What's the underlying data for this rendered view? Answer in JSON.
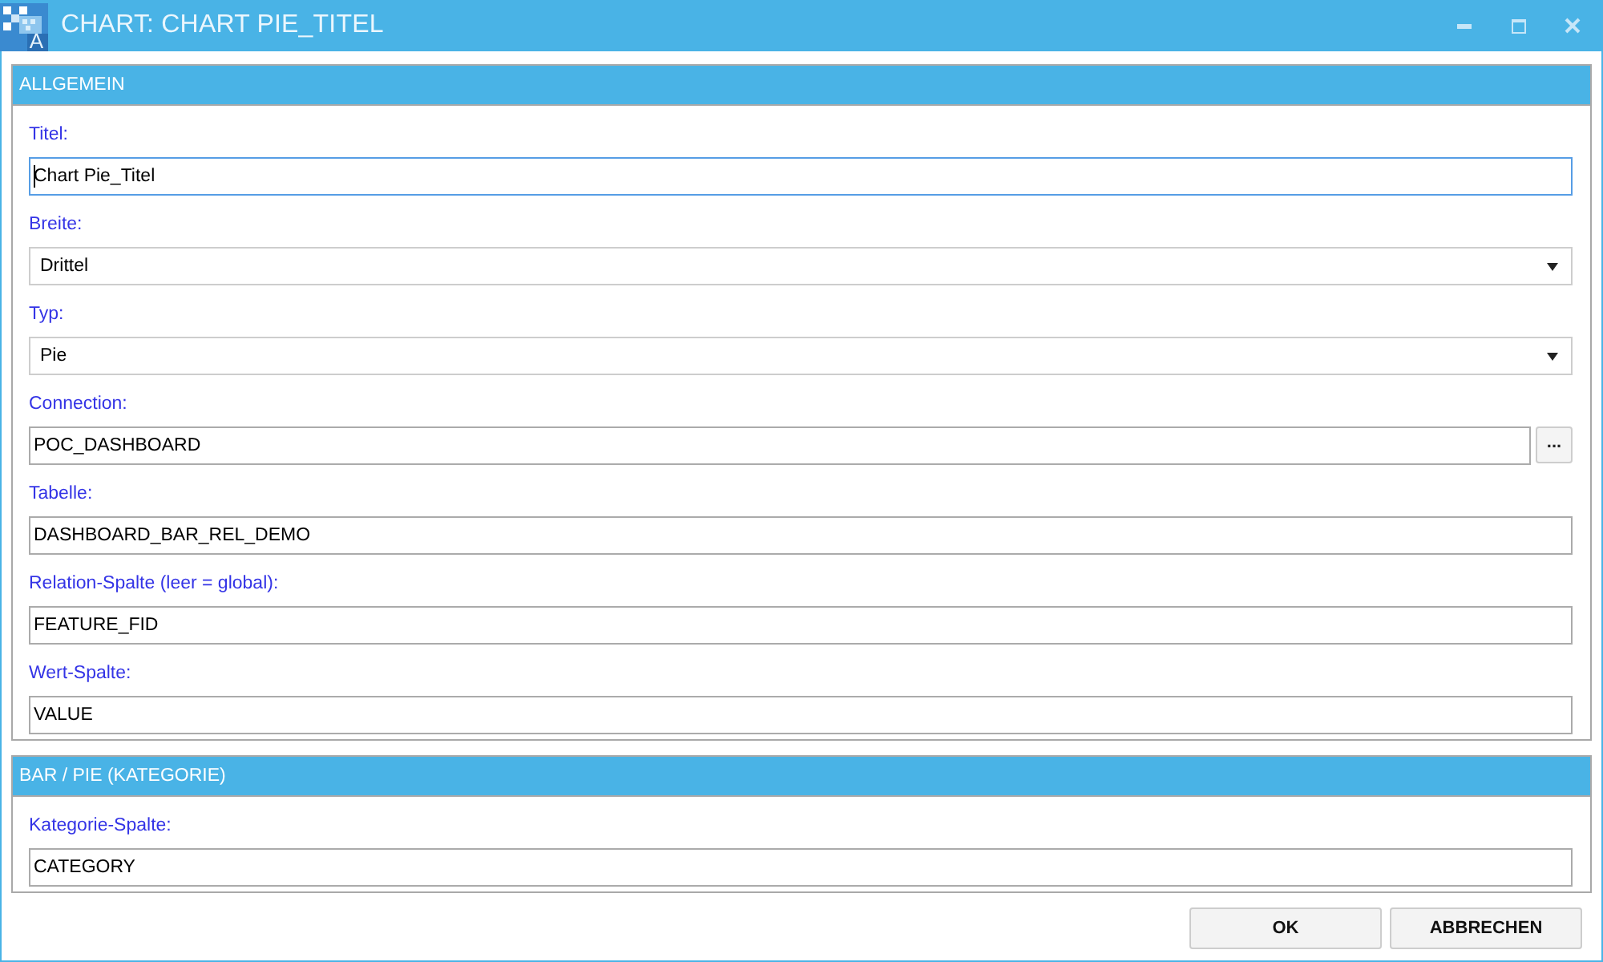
{
  "window": {
    "title": "CHART: CHART PIE_TITEL",
    "icon_letter": "A"
  },
  "sections": [
    {
      "title": "ALLGEMEIN",
      "fields": [
        {
          "kind": "text",
          "label": "Titel:",
          "value": "Chart Pie_Titel",
          "focused": true
        },
        {
          "kind": "dropdown",
          "label": "Breite:",
          "value": "Drittel",
          "focused": false
        },
        {
          "kind": "dropdown",
          "label": "Typ:",
          "value": "Pie",
          "focused": false
        },
        {
          "kind": "browse",
          "label": "Connection:",
          "value": "POC_DASHBOARD",
          "button": "...",
          "focused": false
        },
        {
          "kind": "text",
          "label": "Tabelle:",
          "value": "DASHBOARD_BAR_REL_DEMO",
          "focused": false
        },
        {
          "kind": "text",
          "label": "Relation-Spalte (leer = global):",
          "value": "FEATURE_FID",
          "focused": false
        },
        {
          "kind": "text",
          "label": "Wert-Spalte:",
          "value": "VALUE",
          "focused": false
        }
      ]
    },
    {
      "title": "BAR / PIE (KATEGORIE)",
      "fields": [
        {
          "kind": "text",
          "label": "Kategorie-Spalte:",
          "value": "CATEGORY",
          "focused": false
        }
      ]
    }
  ],
  "buttons": [
    {
      "label": "OK"
    },
    {
      "label": "ABBRECHEN"
    }
  ]
}
